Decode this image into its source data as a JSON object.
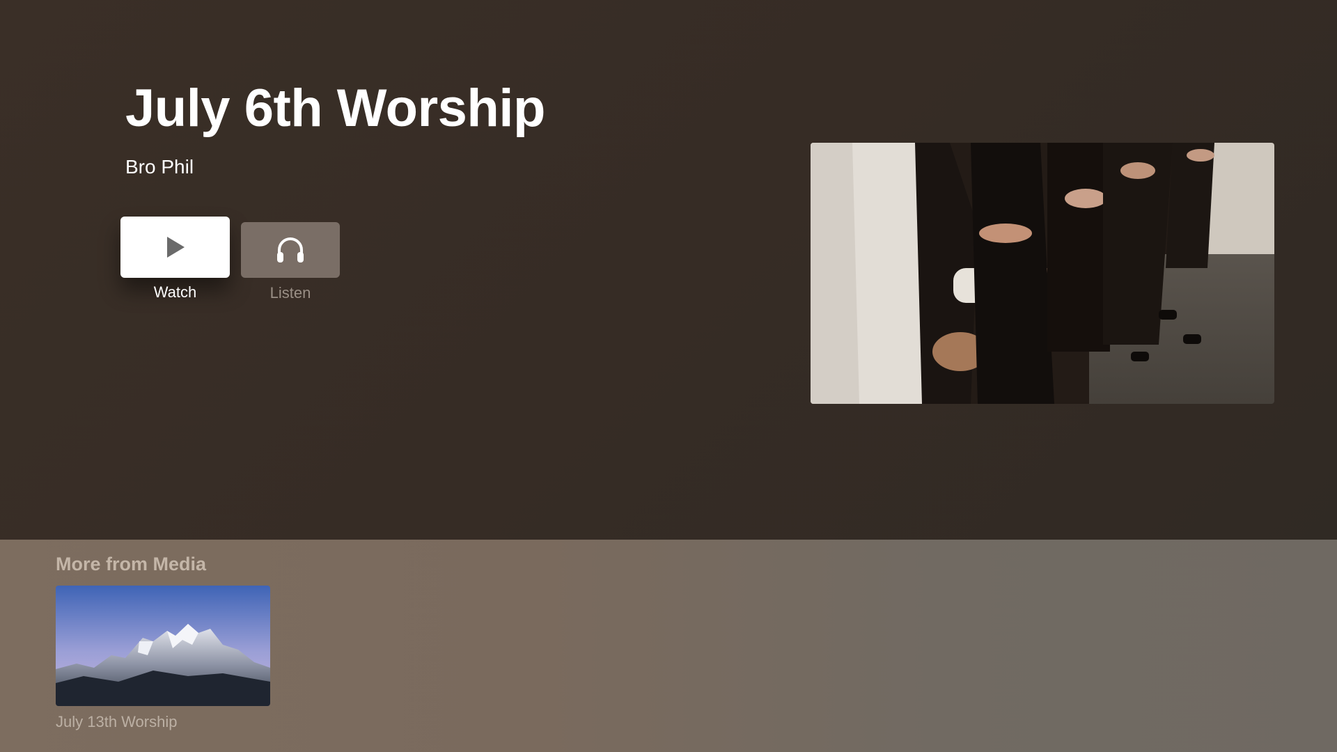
{
  "hero": {
    "title": "July 6th Worship",
    "subtitle": "Bro Phil",
    "actions": [
      {
        "label": "Watch",
        "icon": "play-icon"
      },
      {
        "label": "Listen",
        "icon": "headphones-icon"
      }
    ],
    "image": "worship-congregation-photo"
  },
  "shelf": {
    "title": "More from Media",
    "items": [
      {
        "label": "July 13th Worship",
        "image": "mountain-landscape-photo"
      }
    ]
  },
  "colors": {
    "background": "#382e27",
    "shelf_background": "#7a6b5e",
    "watch_button": "#ffffff",
    "listen_button": "#7a6e66"
  }
}
